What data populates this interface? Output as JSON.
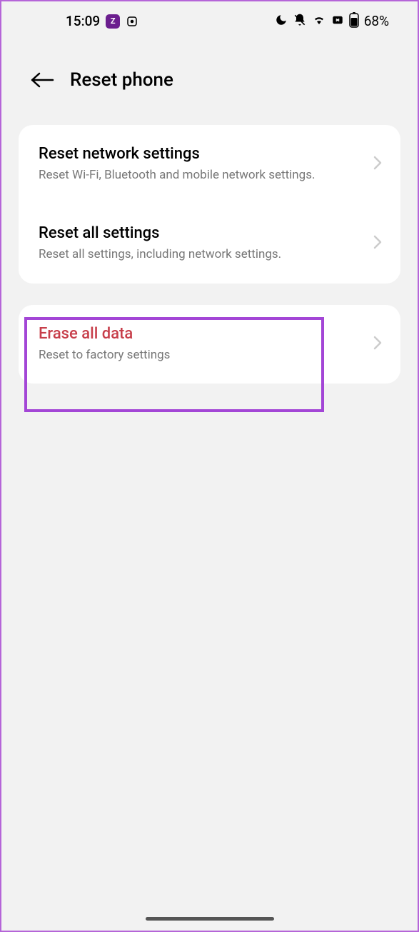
{
  "statusBar": {
    "time": "15:09",
    "appIconLetter": "Z",
    "batteryText": "68%"
  },
  "header": {
    "title": "Reset phone"
  },
  "settings": {
    "group1": [
      {
        "title": "Reset network settings",
        "subtitle": "Reset Wi-Fi, Bluetooth and mobile network settings."
      },
      {
        "title": "Reset all settings",
        "subtitle": "Reset all settings, including network settings."
      }
    ],
    "group2": [
      {
        "title": "Erase all data",
        "subtitle": "Reset to factory settings"
      }
    ]
  }
}
